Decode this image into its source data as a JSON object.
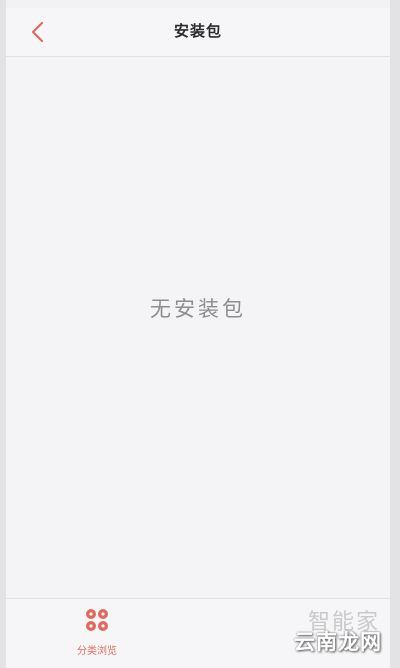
{
  "nav": {
    "title": "安装包",
    "back_icon": "chevron-left-icon"
  },
  "content": {
    "empty_message": "无安装包"
  },
  "tab_bar": {
    "items": [
      {
        "label": "分类浏览",
        "icon": "grid-dots-icon",
        "active": true
      }
    ]
  },
  "watermark": {
    "top_text": "智能家",
    "badge_text": "云南龙网"
  },
  "colors": {
    "accent": "#e06a60",
    "background": "#f4f4f6",
    "title": "#2b2b2b",
    "empty_text": "#8d8d8f"
  }
}
